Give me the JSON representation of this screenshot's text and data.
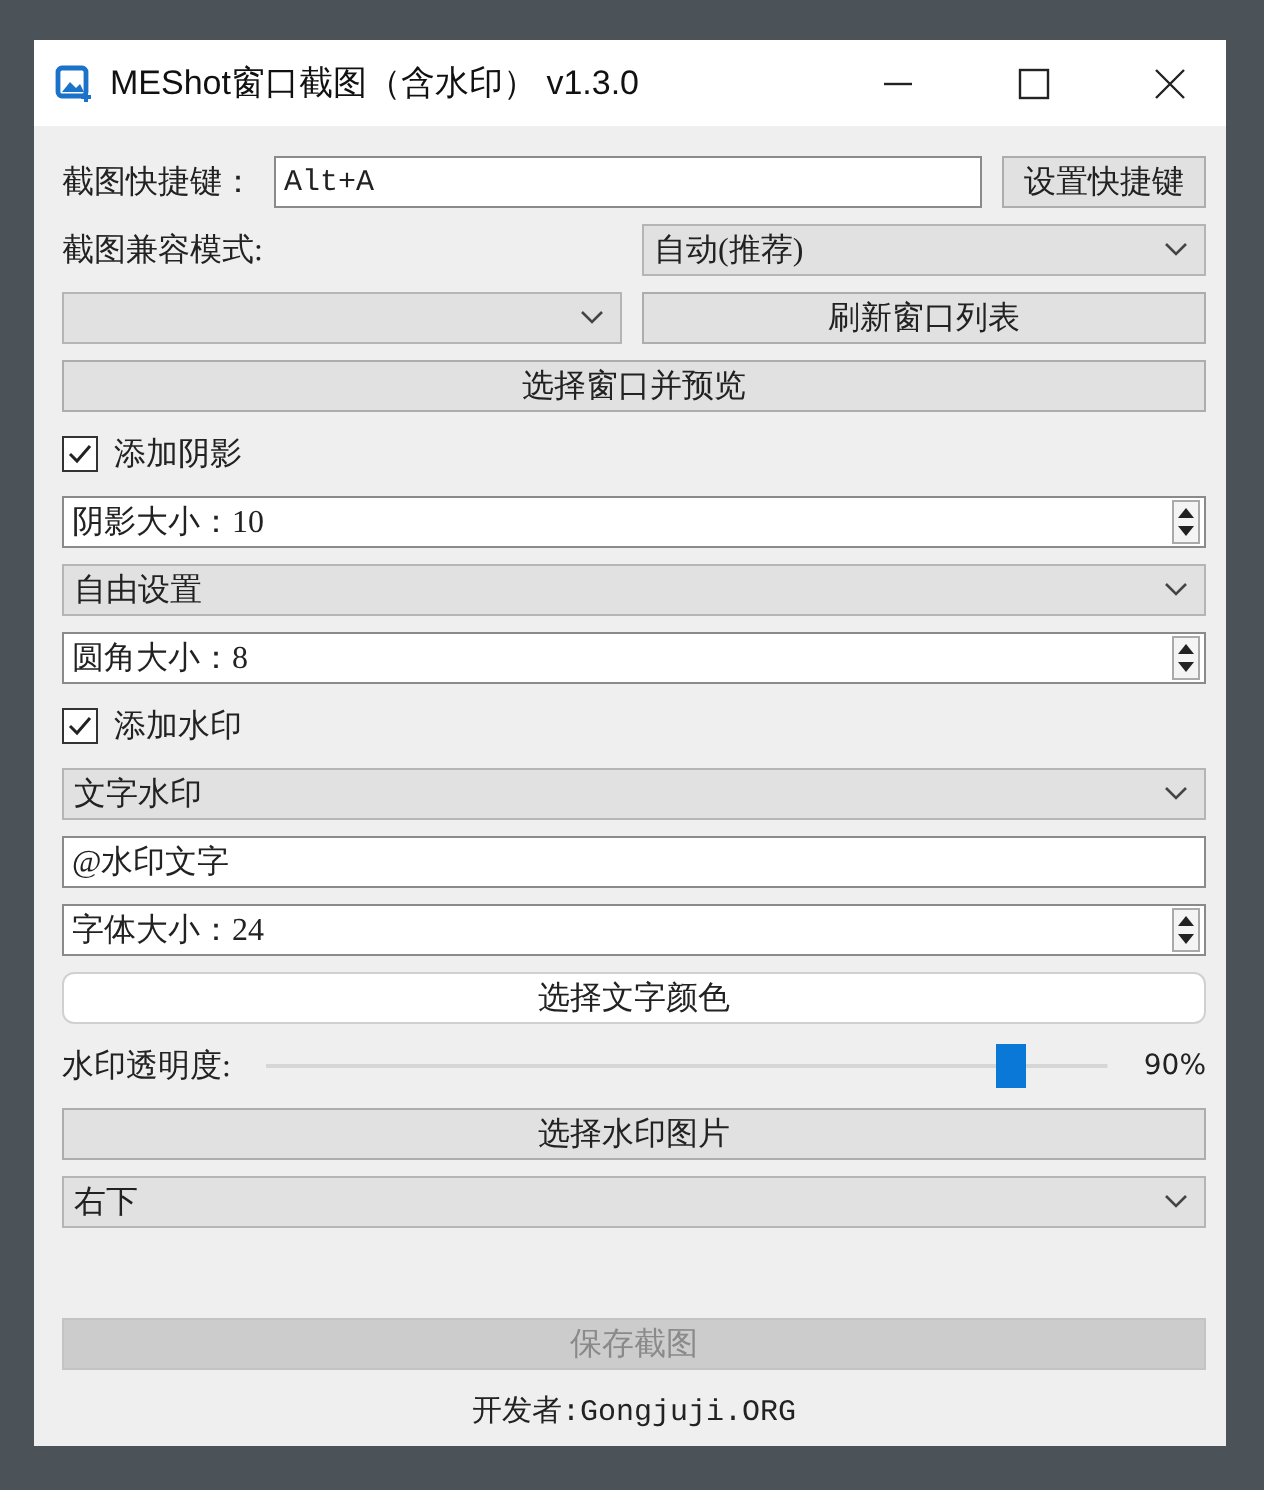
{
  "window": {
    "title": "MEShot窗口截图（含水印） v1.3.0"
  },
  "controls": [
    {
      "kind": "shortcut",
      "label": "截图快捷键：",
      "value": "Alt+A",
      "button": "设置快捷键"
    },
    {
      "kind": "label_select",
      "label": "截图兼容模式:",
      "value": "自动(推荐)"
    },
    {
      "kind": "select_button",
      "button": "刷新窗口列表"
    },
    {
      "kind": "button",
      "label": "选择窗口并预览",
      "disabled": false
    },
    {
      "kind": "checkbox",
      "label": "添加阴影",
      "checked": true
    },
    {
      "kind": "spin",
      "value": "阴影大小：10"
    },
    {
      "kind": "select",
      "value": "自由设置"
    },
    {
      "kind": "spin",
      "value": "圆角大小：8"
    },
    {
      "kind": "checkbox",
      "label": "添加水印",
      "checked": true
    },
    {
      "kind": "select",
      "value": "文字水印"
    },
    {
      "kind": "input",
      "value": "@水印文字"
    },
    {
      "kind": "spin",
      "value": "字体大小：24"
    },
    {
      "kind": "color_button",
      "label": "选择文字颜色",
      "color": "#ffffff"
    },
    {
      "kind": "slider",
      "label": "水印透明度:",
      "level": 0.9,
      "reading": "90%"
    },
    {
      "kind": "button",
      "label": "选择水印图片",
      "disabled": false
    },
    {
      "kind": "select",
      "value": "右下"
    },
    {
      "kind": "spacer"
    },
    {
      "kind": "button",
      "label": "保存截图",
      "disabled": true
    }
  ],
  "footer": "开发者:Gongjuji.ORG"
}
